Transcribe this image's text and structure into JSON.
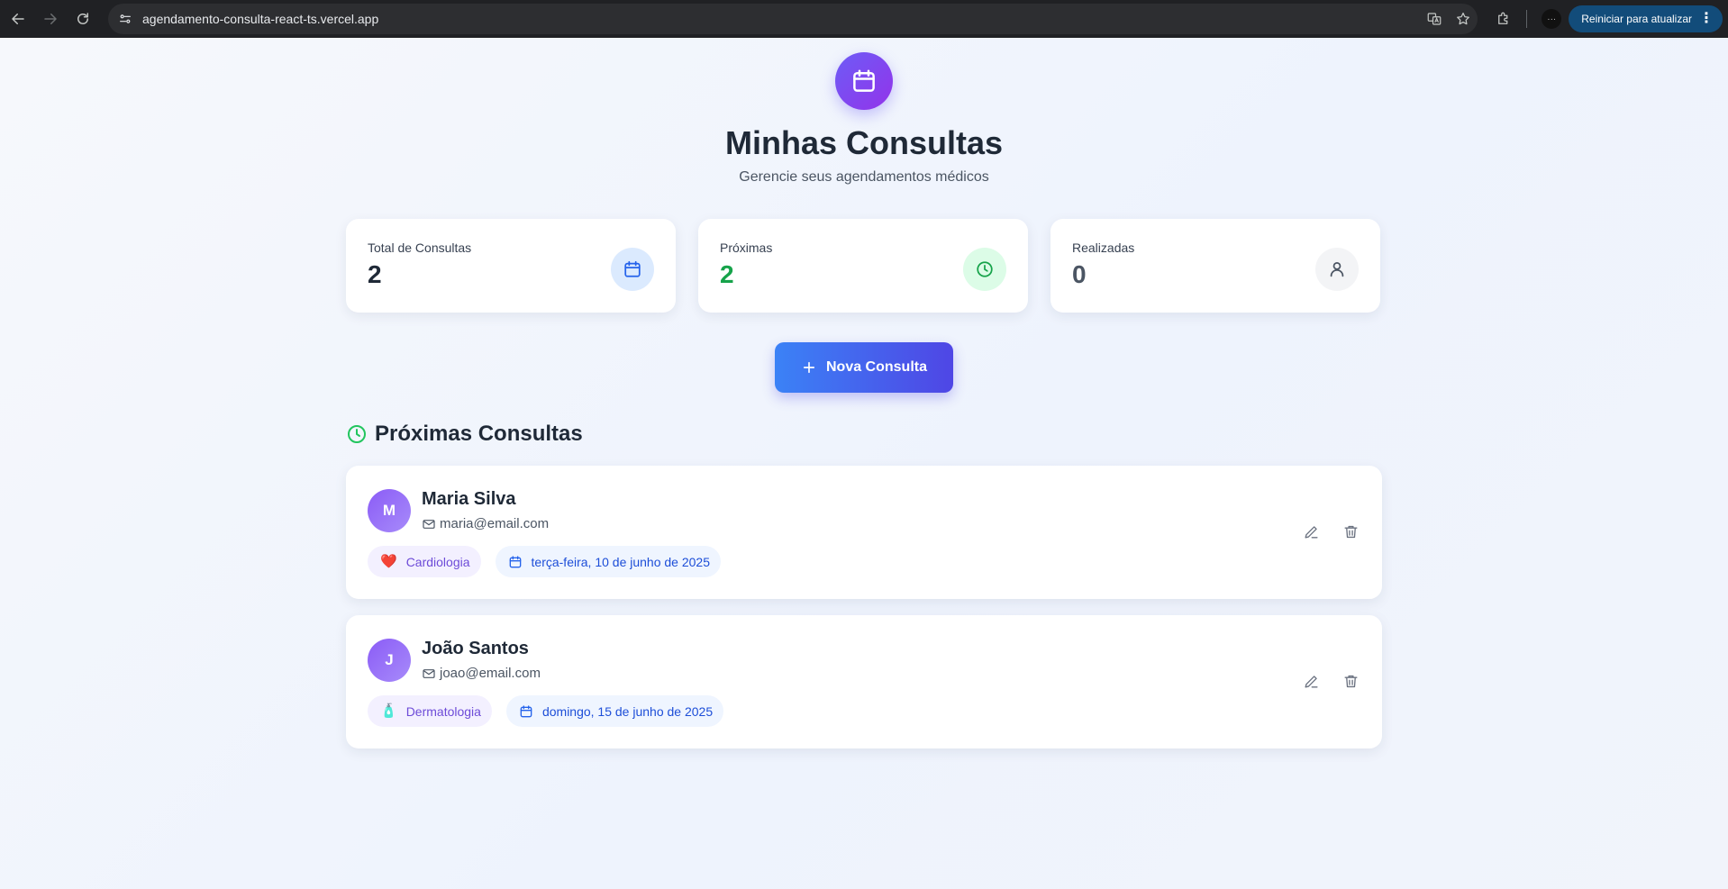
{
  "browser": {
    "url": "agendamento-consulta-react-ts.vercel.app",
    "update_label": "Reiniciar para atualizar",
    "profile_initial": "···"
  },
  "header": {
    "title": "Minhas Consultas",
    "subtitle": "Gerencie seus agendamentos médicos"
  },
  "stats": [
    {
      "label": "Total de Consultas",
      "value": "2",
      "color": "#1f2937",
      "icon": "calendar-icon",
      "icon_bg": "#dbeafe",
      "icon_color": "#2563eb"
    },
    {
      "label": "Próximas",
      "value": "2",
      "color": "#16a34a",
      "icon": "clock-icon",
      "icon_bg": "#dcfce7",
      "icon_color": "#16a34a"
    },
    {
      "label": "Realizadas",
      "value": "0",
      "color": "#4b5563",
      "icon": "user-icon",
      "icon_bg": "#f3f4f6",
      "icon_color": "#4b5563"
    }
  ],
  "new_button": {
    "label": "Nova Consulta"
  },
  "section": {
    "title": "Próximas Consultas"
  },
  "appointments": [
    {
      "initial": "M",
      "name": "Maria Silva",
      "email": "maria@email.com",
      "specialty_emoji": "❤️",
      "specialty": "Cardiologia",
      "date": "terça-feira, 10 de junho de 2025"
    },
    {
      "initial": "J",
      "name": "João Santos",
      "email": "joao@email.com",
      "specialty_emoji": "🧴",
      "specialty": "Dermatologia",
      "date": "domingo, 15 de junho de 2025"
    }
  ]
}
